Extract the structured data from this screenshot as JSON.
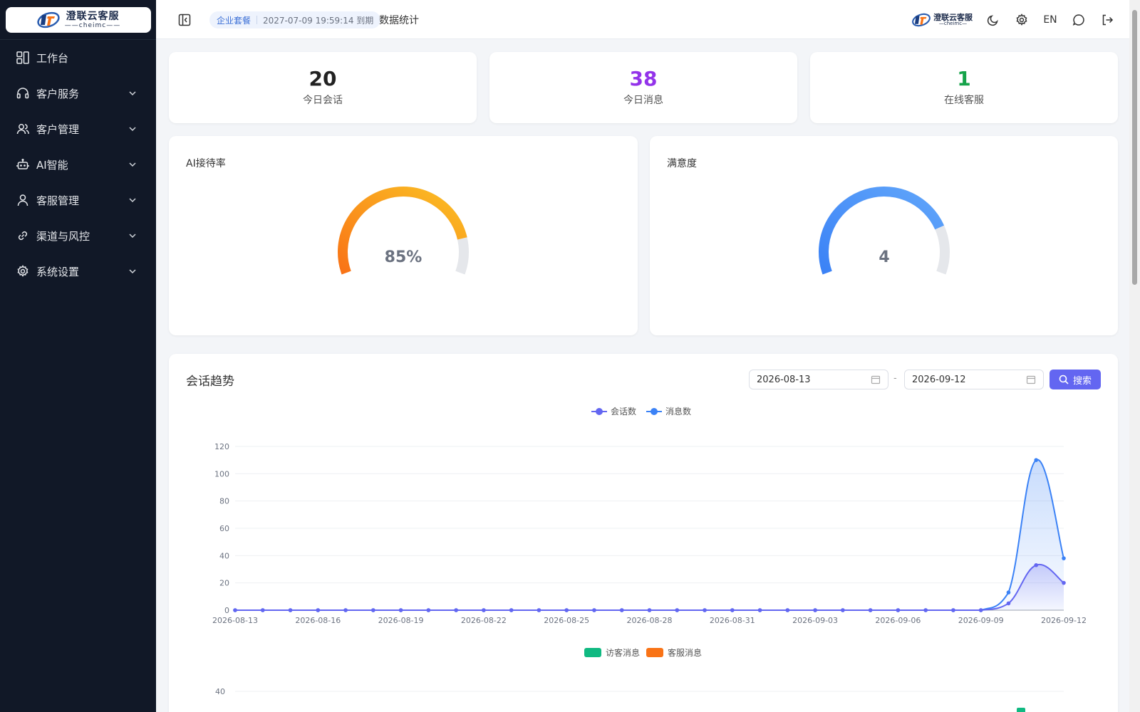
{
  "sidebar": {
    "logo": {
      "cn": "澄联云客服",
      "en": "cheimc"
    },
    "items": [
      {
        "label": "工作台",
        "icon": "grid-icon",
        "expandable": false
      },
      {
        "label": "客户服务",
        "icon": "headset-icon",
        "expandable": true
      },
      {
        "label": "客户管理",
        "icon": "users-icon",
        "expandable": true
      },
      {
        "label": "AI智能",
        "icon": "robot-icon",
        "expandable": true
      },
      {
        "label": "客服管理",
        "icon": "user-icon",
        "expandable": true
      },
      {
        "label": "渠道与风控",
        "icon": "link-icon",
        "expandable": true
      },
      {
        "label": "系统设置",
        "icon": "gear-icon",
        "expandable": true
      }
    ]
  },
  "header": {
    "plan": "企业套餐",
    "expire": "2027-07-09 19:59:14 到期",
    "title": "数据统计",
    "logo": {
      "cn": "澄联云客服",
      "en": "cheimc"
    },
    "lang": "EN"
  },
  "stats": [
    {
      "value": "20",
      "label": "今日会话",
      "color": "#222222"
    },
    {
      "value": "38",
      "label": "今日消息",
      "color": "#9333ea"
    },
    {
      "value": "1",
      "label": "在线客服",
      "color": "#16a34a"
    }
  ],
  "gauges": [
    {
      "title": "AI接待率",
      "display": "85%",
      "fraction": 0.85,
      "colors": [
        "#f97316",
        "#fbbf24"
      ]
    },
    {
      "title": "满意度",
      "display": "4",
      "fraction": 0.8,
      "colors": [
        "#3b82f6",
        "#60a5fa"
      ]
    }
  ],
  "trend": {
    "title": "会话趋势",
    "start_date": "2026-08-13",
    "end_date": "2026-09-12",
    "date_sep": "-",
    "search_label": "搜索"
  },
  "chart_data": [
    {
      "type": "line",
      "legend": [
        "会话数",
        "消息数"
      ],
      "x": [
        "2026-08-13",
        "2026-08-14",
        "2026-08-15",
        "2026-08-16",
        "2026-08-17",
        "2026-08-18",
        "2026-08-19",
        "2026-08-20",
        "2026-08-21",
        "2026-08-22",
        "2026-08-23",
        "2026-08-24",
        "2026-08-25",
        "2026-08-26",
        "2026-08-27",
        "2026-08-28",
        "2026-08-29",
        "2026-08-30",
        "2026-08-31",
        "2026-09-01",
        "2026-09-02",
        "2026-09-03",
        "2026-09-04",
        "2026-09-05",
        "2026-09-06",
        "2026-09-07",
        "2026-09-08",
        "2026-09-09",
        "2026-09-10",
        "2026-09-11",
        "2026-09-12"
      ],
      "x_tick_labels": [
        "2026-08-13",
        "2026-08-16",
        "2026-08-19",
        "2026-08-22",
        "2026-08-25",
        "2026-08-28",
        "2026-08-31",
        "2026-09-03",
        "2026-09-06",
        "2026-09-09",
        "2026-09-12"
      ],
      "series": [
        {
          "name": "会话数",
          "color": "#6366f1",
          "values": [
            0,
            0,
            0,
            0,
            0,
            0,
            0,
            0,
            0,
            0,
            0,
            0,
            0,
            0,
            0,
            0,
            0,
            0,
            0,
            0,
            0,
            0,
            0,
            0,
            0,
            0,
            0,
            0,
            5,
            33,
            20
          ]
        },
        {
          "name": "消息数",
          "color": "#3b82f6",
          "values": [
            0,
            0,
            0,
            0,
            0,
            0,
            0,
            0,
            0,
            0,
            0,
            0,
            0,
            0,
            0,
            0,
            0,
            0,
            0,
            0,
            0,
            0,
            0,
            0,
            0,
            0,
            0,
            0,
            13,
            110,
            38
          ]
        }
      ],
      "ylim": [
        0,
        120
      ],
      "y_ticks": [
        "0",
        "20",
        "40",
        "60",
        "80",
        "100",
        "120"
      ],
      "grid": true,
      "legend_position": "top-center"
    },
    {
      "type": "bar",
      "legend": [
        "访客消息",
        "客服消息"
      ],
      "series": [
        {
          "name": "访客消息",
          "color": "#10b981"
        },
        {
          "name": "客服消息",
          "color": "#f97316"
        }
      ],
      "y_ticks": [
        "40"
      ],
      "legend_position": "top-center"
    }
  ]
}
